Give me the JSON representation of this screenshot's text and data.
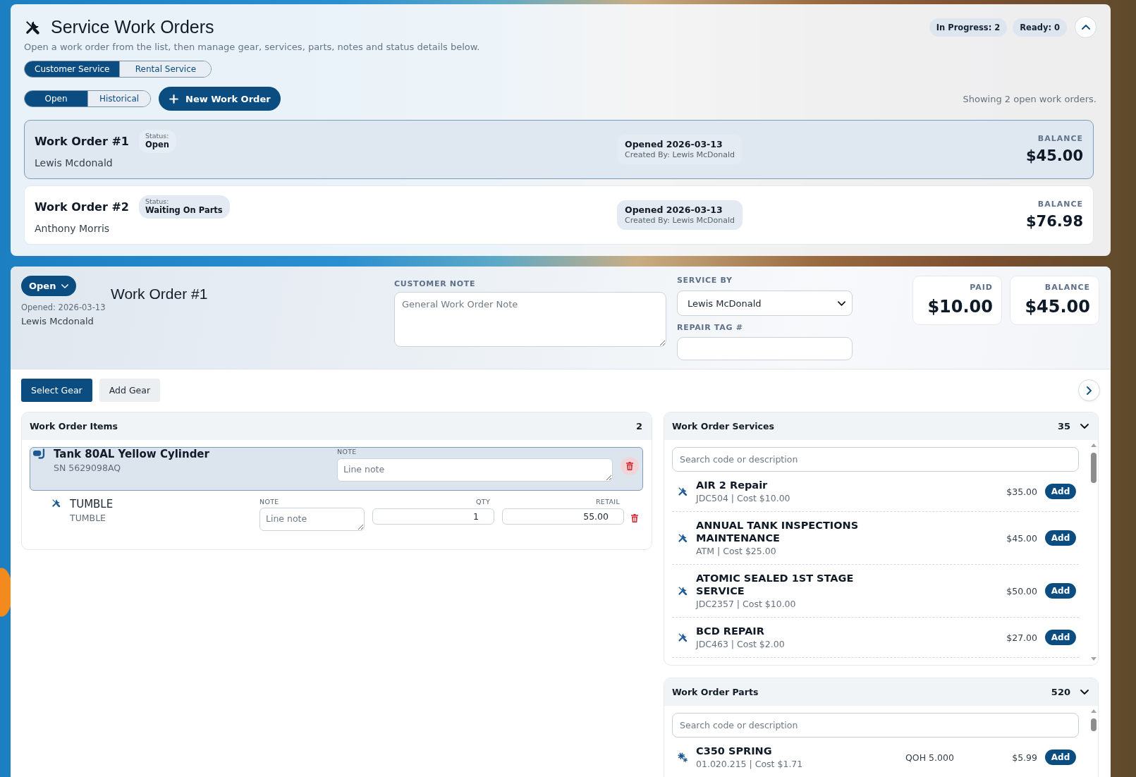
{
  "header": {
    "title": "Service Work Orders",
    "subtitle": "Open a work order from the list, then manage gear, services, parts, notes and status details below.",
    "counters": [
      "In Progress: 2",
      "Ready: 0"
    ]
  },
  "service_tabs": [
    {
      "label": "Customer Service",
      "selected": true
    },
    {
      "label": "Rental Service",
      "selected": false
    }
  ],
  "filter_tabs": [
    {
      "label": "Open",
      "selected": true
    },
    {
      "label": "Historical",
      "selected": false
    }
  ],
  "new_work_order_button": {
    "label": "New Work Order"
  },
  "list_summary": "Showing 2 open work orders.",
  "work_orders": [
    {
      "title": "Work Order #1",
      "status_label": "Status:",
      "status": "Open",
      "customer": "Lewis Mcdonald",
      "opened": "Opened 2026-03-13",
      "created_by": "Created By: Lewis McDonald",
      "balance_label": "BALANCE",
      "balance": "$45.00",
      "selected": true
    },
    {
      "title": "Work Order #2",
      "status_label": "Status:",
      "status": "Waiting On Parts",
      "customer": "Anthony Morris",
      "opened": "Opened 2026-03-13",
      "created_by": "Created By: Lewis McDonald",
      "balance_label": "BALANCE",
      "balance": "$76.98",
      "selected": false
    }
  ],
  "detail": {
    "status": "Open",
    "opened": "Opened: 2026-03-13",
    "customer": "Lewis Mcdonald",
    "title": "Work Order #1",
    "customer_note": {
      "label": "CUSTOMER NOTE",
      "placeholder": "General Work Order Note"
    },
    "service_by": {
      "label": "SERVICE BY",
      "value": "Lewis McDonald"
    },
    "repair_tag": {
      "label": "REPAIR TAG #"
    },
    "totals": [
      {
        "label": "PAID",
        "value": "$10.00"
      },
      {
        "label": "BALANCE",
        "value": "$45.00"
      }
    ]
  },
  "gear_tabs": [
    {
      "label": "Select Gear",
      "selected": true
    },
    {
      "label": "Add Gear",
      "selected": false
    }
  ],
  "items_panel": {
    "title": "Work Order Items",
    "count": "2",
    "gear": [
      {
        "name": "Tank 80AL Yellow Cylinder",
        "serial": "SN 5629098AQ",
        "note_label": "NOTE",
        "note_placeholder": "Line note",
        "selected": true,
        "children": [
          {
            "name": "TUMBLE",
            "code": "TUMBLE",
            "note_label": "NOTE",
            "note_placeholder": "Line note",
            "qty_label": "QTY",
            "qty": "1",
            "retail_label": "RETAIL",
            "retail": "55.00"
          }
        ]
      }
    ]
  },
  "services_panel": {
    "title": "Work Order Services",
    "count": "35",
    "search_placeholder": "Search code or description",
    "rows": [
      {
        "name": "AIR 2 Repair",
        "detail": "JDC504 | Cost $10.00",
        "price": "$35.00",
        "action": "Add"
      },
      {
        "name": "ANNUAL TANK INSPECTIONS MAINTENANCE",
        "detail": "ATM | Cost $25.00",
        "price": "$45.00",
        "action": "Add"
      },
      {
        "name": "ATOMIC SEALED 1ST STAGE SERVICE",
        "detail": "JDC2357 | Cost $10.00",
        "price": "$50.00",
        "action": "Add"
      },
      {
        "name": "BCD REPAIR",
        "detail": "JDC463 | Cost $2.00",
        "price": "$27.00",
        "action": "Add"
      }
    ]
  },
  "parts_panel": {
    "title": "Work Order Parts",
    "count": "520",
    "search_placeholder": "Search code or description",
    "rows": [
      {
        "name": "C350 SPRING",
        "detail": "01.020.215 | Cost $1.71",
        "stock": "QOH 5.000",
        "price": "$5.99",
        "action": "Add"
      }
    ]
  }
}
